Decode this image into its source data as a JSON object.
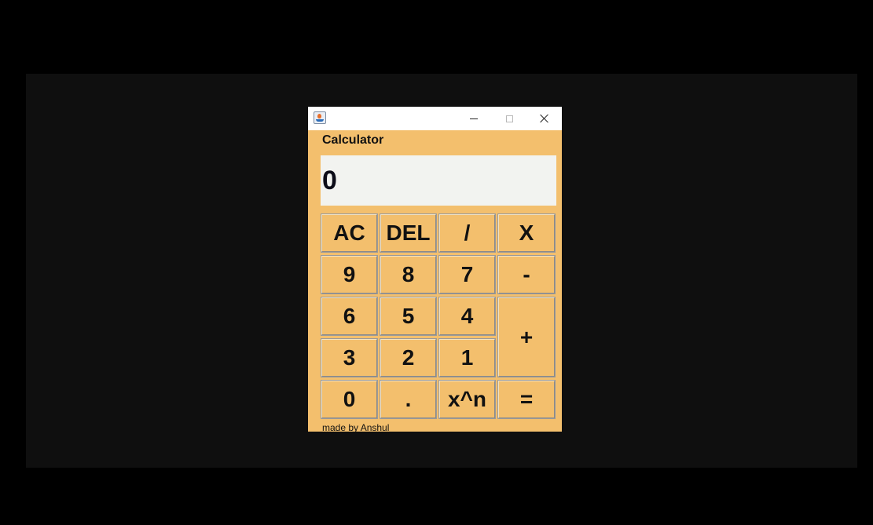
{
  "window": {
    "icon": "java-app-icon",
    "controls": {
      "minimize": "minimize-icon",
      "maximize": "maximize-icon",
      "close": "close-icon"
    }
  },
  "app": {
    "title": "Calculator",
    "display_value": "0",
    "footer": "made by Anshul"
  },
  "keys": {
    "ac": "AC",
    "del": "DEL",
    "divide": "/",
    "multiply": "X",
    "nine": "9",
    "eight": "8",
    "seven": "7",
    "minus": "-",
    "six": "6",
    "five": "5",
    "four": "4",
    "plus": "+",
    "three": "3",
    "two": "2",
    "one": "1",
    "zero": "0",
    "decimal": ".",
    "power": "x^n",
    "equals": "="
  },
  "colors": {
    "panel": "#f3bf6d",
    "display_bg": "#f2f3f0",
    "desktop": "#0f0f0f",
    "background": "#000000"
  }
}
